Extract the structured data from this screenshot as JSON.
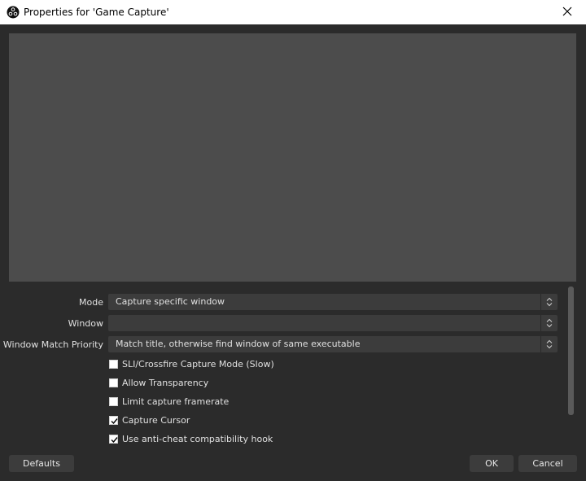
{
  "window": {
    "title": "Properties for 'Game Capture'",
    "app_icon": "obs-logo-icon",
    "close_icon": "close-icon"
  },
  "preview": {
    "background": "#4c4c4c"
  },
  "properties": {
    "mode": {
      "label": "Mode",
      "value": "Capture specific window"
    },
    "window": {
      "label": "Window",
      "value": ""
    },
    "window_match_priority": {
      "label": "Window Match Priority",
      "value": "Match title, otherwise find window of same executable"
    }
  },
  "checkboxes": [
    {
      "label": "SLI/Crossfire Capture Mode (Slow)",
      "checked": false
    },
    {
      "label": "Allow Transparency",
      "checked": false
    },
    {
      "label": "Limit capture framerate",
      "checked": false
    },
    {
      "label": "Capture Cursor",
      "checked": true
    },
    {
      "label": "Use anti-cheat compatibility hook",
      "checked": true
    }
  ],
  "buttons": {
    "defaults": "Defaults",
    "ok": "OK",
    "cancel": "Cancel"
  }
}
